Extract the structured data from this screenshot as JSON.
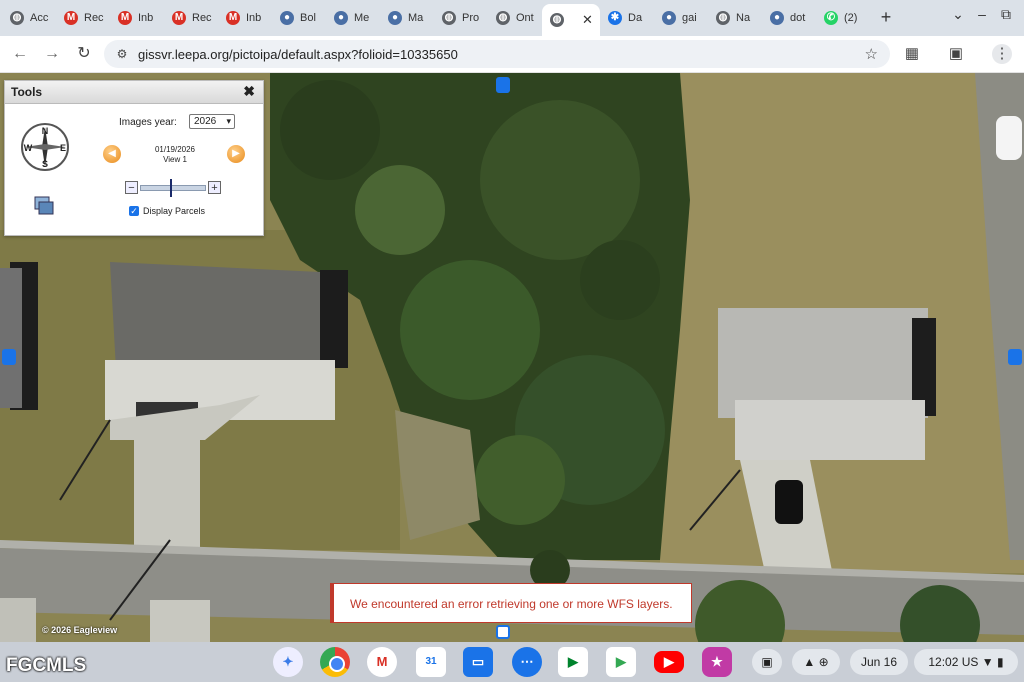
{
  "tabs": [
    {
      "label": "Acc",
      "icon": "globe-icon"
    },
    {
      "label": "Rec",
      "icon": "gmail-icon"
    },
    {
      "label": "Inb",
      "icon": "gmail-icon"
    },
    {
      "label": "Rec",
      "icon": "gmail-icon"
    },
    {
      "label": "Inb",
      "icon": "gmail-icon"
    },
    {
      "label": "Bol",
      "icon": "site-icon"
    },
    {
      "label": "Me",
      "icon": "site-icon"
    },
    {
      "label": "Ma",
      "icon": "site-icon"
    },
    {
      "label": "Pro",
      "icon": "globe-icon"
    },
    {
      "label": "Ont",
      "icon": "globe-icon"
    },
    {
      "label": "",
      "icon": "globe-icon",
      "active": true
    },
    {
      "label": "Da",
      "icon": "gear-icon"
    },
    {
      "label": "gai",
      "icon": "site-icon"
    },
    {
      "label": "Na",
      "icon": "globe-icon"
    },
    {
      "label": "dot",
      "icon": "site-icon"
    },
    {
      "label": "(2)",
      "icon": "whatsapp-icon"
    }
  ],
  "browser": {
    "url": "gissvr.leepa.org/pictoipa/default.aspx?folioid=10335650"
  },
  "tools_panel": {
    "title": "Tools",
    "close": "✖",
    "images_year_label": "Images year:",
    "images_year_value": "2026",
    "date": "01/19/2026",
    "view": "View 1",
    "display_parcels_label": "Display Parcels",
    "display_parcels_checked": true,
    "compass_labels": {
      "n": "N",
      "s": "S",
      "e": "E",
      "w": "W"
    }
  },
  "map": {
    "error_message": "We encountered an error retrieving one or more WFS layers.",
    "copyright": "© 2026 Eagleview"
  },
  "watermark": "FGCMLS",
  "shelf": {
    "apps": [
      "gemini-icon",
      "chrome-icon",
      "gmail-icon",
      "calendar-icon",
      "files-icon",
      "messages-icon",
      "meet-icon",
      "play-store-icon",
      "youtube-icon",
      "app-icon"
    ],
    "calendar_badge": "31",
    "date": "Jun 16",
    "time": "12:02",
    "locale": "US"
  },
  "colors": {
    "error": "#c0392b",
    "accent": "#1a73e8"
  }
}
